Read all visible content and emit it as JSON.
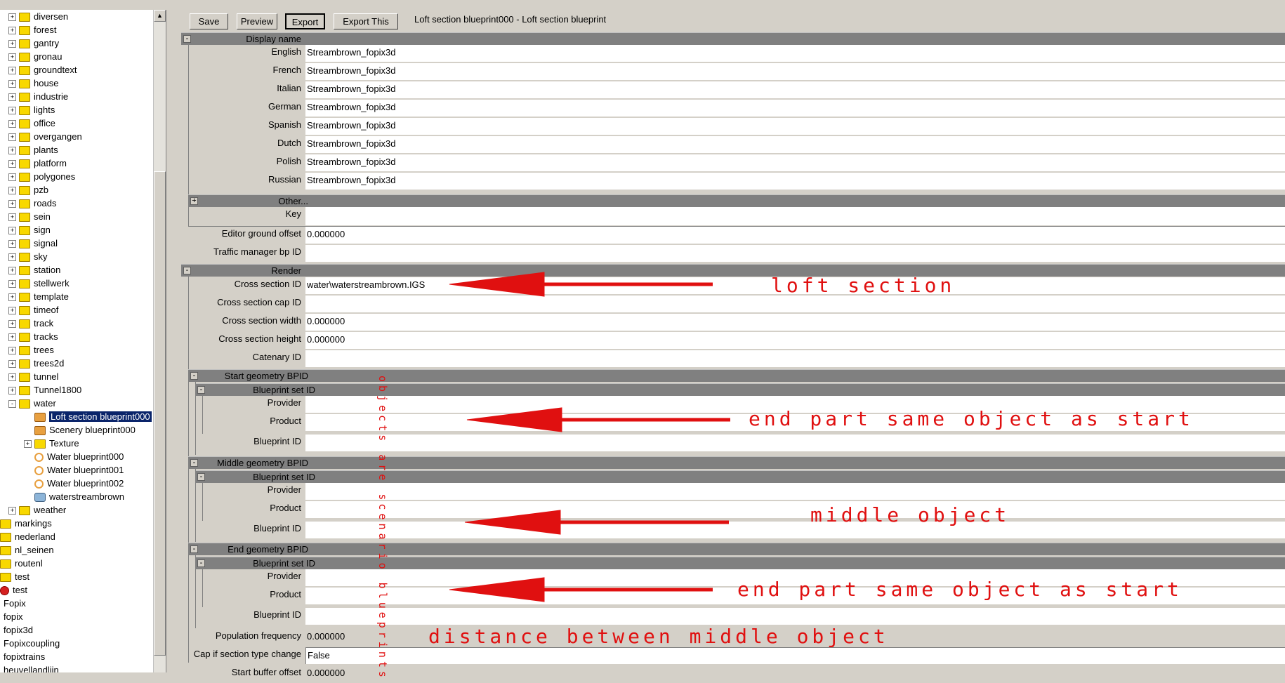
{
  "toolbar": {
    "save": "Save",
    "preview": "Preview",
    "export": "Export",
    "export_this": "Export This",
    "window_title": "Loft section blueprint000 - Loft section blueprint"
  },
  "tree": [
    {
      "label": "diversen",
      "expander": "+",
      "icon": "folder",
      "indent": 1
    },
    {
      "label": "forest",
      "expander": "+",
      "icon": "folder",
      "indent": 1
    },
    {
      "label": "gantry",
      "expander": "+",
      "icon": "folder",
      "indent": 1
    },
    {
      "label": "gronau",
      "expander": "+",
      "icon": "folder",
      "indent": 1
    },
    {
      "label": "groundtext",
      "expander": "+",
      "icon": "folder",
      "indent": 1
    },
    {
      "label": "house",
      "expander": "+",
      "icon": "folder",
      "indent": 1
    },
    {
      "label": "industrie",
      "expander": "+",
      "icon": "folder",
      "indent": 1
    },
    {
      "label": "lights",
      "expander": "+",
      "icon": "folder",
      "indent": 1
    },
    {
      "label": "office",
      "expander": "+",
      "icon": "folder",
      "indent": 1
    },
    {
      "label": "overgangen",
      "expander": "+",
      "icon": "folder",
      "indent": 1
    },
    {
      "label": "plants",
      "expander": "+",
      "icon": "folder",
      "indent": 1
    },
    {
      "label": "platform",
      "expander": "+",
      "icon": "folder",
      "indent": 1
    },
    {
      "label": "polygones",
      "expander": "+",
      "icon": "folder",
      "indent": 1
    },
    {
      "label": "pzb",
      "expander": "+",
      "icon": "folder",
      "indent": 1
    },
    {
      "label": "roads",
      "expander": "+",
      "icon": "folder",
      "indent": 1
    },
    {
      "label": "sein",
      "expander": "+",
      "icon": "folder",
      "indent": 1
    },
    {
      "label": "sign",
      "expander": "+",
      "icon": "folder",
      "indent": 1
    },
    {
      "label": "signal",
      "expander": "+",
      "icon": "folder",
      "indent": 1
    },
    {
      "label": "sky",
      "expander": "+",
      "icon": "folder",
      "indent": 1
    },
    {
      "label": "station",
      "expander": "+",
      "icon": "folder",
      "indent": 1
    },
    {
      "label": "stellwerk",
      "expander": "+",
      "icon": "folder",
      "indent": 1
    },
    {
      "label": "template",
      "expander": "+",
      "icon": "folder",
      "indent": 1
    },
    {
      "label": "timeof",
      "expander": "+",
      "icon": "folder",
      "indent": 1
    },
    {
      "label": "track",
      "expander": "+",
      "icon": "folder",
      "indent": 1
    },
    {
      "label": "tracks",
      "expander": "+",
      "icon": "folder",
      "indent": 1
    },
    {
      "label": "trees",
      "expander": "+",
      "icon": "folder",
      "indent": 1
    },
    {
      "label": "trees2d",
      "expander": "+",
      "icon": "folder",
      "indent": 1
    },
    {
      "label": "tunnel",
      "expander": "+",
      "icon": "folder",
      "indent": 1
    },
    {
      "label": "Tunnel1800",
      "expander": "+",
      "icon": "folder",
      "indent": 1
    },
    {
      "label": "water",
      "expander": "-",
      "icon": "folder",
      "indent": 1
    },
    {
      "label": "Loft section blueprint000",
      "expander": "",
      "icon": "bp",
      "indent": 2,
      "selected": true
    },
    {
      "label": "Scenery blueprint000",
      "expander": "",
      "icon": "bp",
      "indent": 2
    },
    {
      "label": "Texture",
      "expander": "+",
      "icon": "folder",
      "indent": 2
    },
    {
      "label": "Water blueprint000",
      "expander": "",
      "icon": "wat",
      "indent": 2
    },
    {
      "label": "Water blueprint001",
      "expander": "",
      "icon": "wat",
      "indent": 2
    },
    {
      "label": "Water blueprint002",
      "expander": "",
      "icon": "wat",
      "indent": 2
    },
    {
      "label": "waterstreambrown",
      "expander": "",
      "icon": "stream",
      "indent": 2
    },
    {
      "label": "weather",
      "expander": "+",
      "icon": "folder",
      "indent": 1
    },
    {
      "label": "markings",
      "expander": "",
      "icon": "folder",
      "indent": 0
    },
    {
      "label": "nederland",
      "expander": "",
      "icon": "folder",
      "indent": 0
    },
    {
      "label": "nl_seinen",
      "expander": "",
      "icon": "folder",
      "indent": 0
    },
    {
      "label": "routenl",
      "expander": "",
      "icon": "folder",
      "indent": 0
    },
    {
      "label": "test",
      "expander": "",
      "icon": "folder",
      "indent": 0
    },
    {
      "label": "test",
      "expander": "",
      "icon": "red",
      "indent": 0
    },
    {
      "label": "Fopix",
      "expander": "",
      "icon": "",
      "indent": -1
    },
    {
      "label": "fopix",
      "expander": "",
      "icon": "",
      "indent": -1
    },
    {
      "label": "fopix3d",
      "expander": "",
      "icon": "",
      "indent": -1
    },
    {
      "label": "Fopixcoupling",
      "expander": "",
      "icon": "",
      "indent": -1
    },
    {
      "label": "fopixtrains",
      "expander": "",
      "icon": "",
      "indent": -1
    },
    {
      "label": "heuvellandlijn",
      "expander": "",
      "icon": "",
      "indent": -1
    }
  ],
  "grid": {
    "display_name": "Display name",
    "languages": [
      {
        "label": "English",
        "value": "Streambrown_fopix3d"
      },
      {
        "label": "French",
        "value": "Streambrown_fopix3d"
      },
      {
        "label": "Italian",
        "value": "Streambrown_fopix3d"
      },
      {
        "label": "German",
        "value": "Streambrown_fopix3d"
      },
      {
        "label": "Spanish",
        "value": "Streambrown_fopix3d"
      },
      {
        "label": "Dutch",
        "value": "Streambrown_fopix3d"
      },
      {
        "label": "Polish",
        "value": "Streambrown_fopix3d"
      },
      {
        "label": "Russian",
        "value": "Streambrown_fopix3d"
      }
    ],
    "other": "Other...",
    "key": "Key",
    "editor_ground_offset": {
      "label": "Editor ground offset",
      "value": "0.000000"
    },
    "traffic_manager": {
      "label": "Traffic manager bp ID",
      "value": ""
    },
    "render": "Render",
    "cross_section_id": {
      "label": "Cross section ID",
      "value": "water\\waterstreambrown.IGS"
    },
    "cross_section_cap_id": {
      "label": "Cross section cap ID",
      "value": ""
    },
    "cross_section_width": {
      "label": "Cross section width",
      "value": "0.000000"
    },
    "cross_section_height": {
      "label": "Cross section height",
      "value": "0.000000"
    },
    "catenary_id": {
      "label": "Catenary ID",
      "value": ""
    },
    "start_geometry": "Start geometry BPID",
    "middle_geometry": "Middle geometry BPID",
    "end_geometry": "End geometry BPID",
    "blueprint_set_id": "Blueprint set ID",
    "provider": "Provider",
    "product": "Product",
    "blueprint_id": "Blueprint ID",
    "population_frequency": {
      "label": "Population frequency",
      "value": "0.000000"
    },
    "cap_if_section": {
      "label": "Cap if section type change",
      "value": "False"
    },
    "start_buffer_offset": {
      "label": "Start buffer offset",
      "value": "0.000000"
    }
  },
  "annotations": {
    "loft_section": "loft section",
    "end_part_1": "end part same object as start",
    "middle_object": "middle object",
    "end_part_2": "end part same object as start",
    "distance": "distance between middle object",
    "vertical": "objects are scenario blueprints"
  },
  "colors": {
    "annotation_red": "#e01010",
    "section_gray": "#808080",
    "selection": "#0a246a"
  }
}
